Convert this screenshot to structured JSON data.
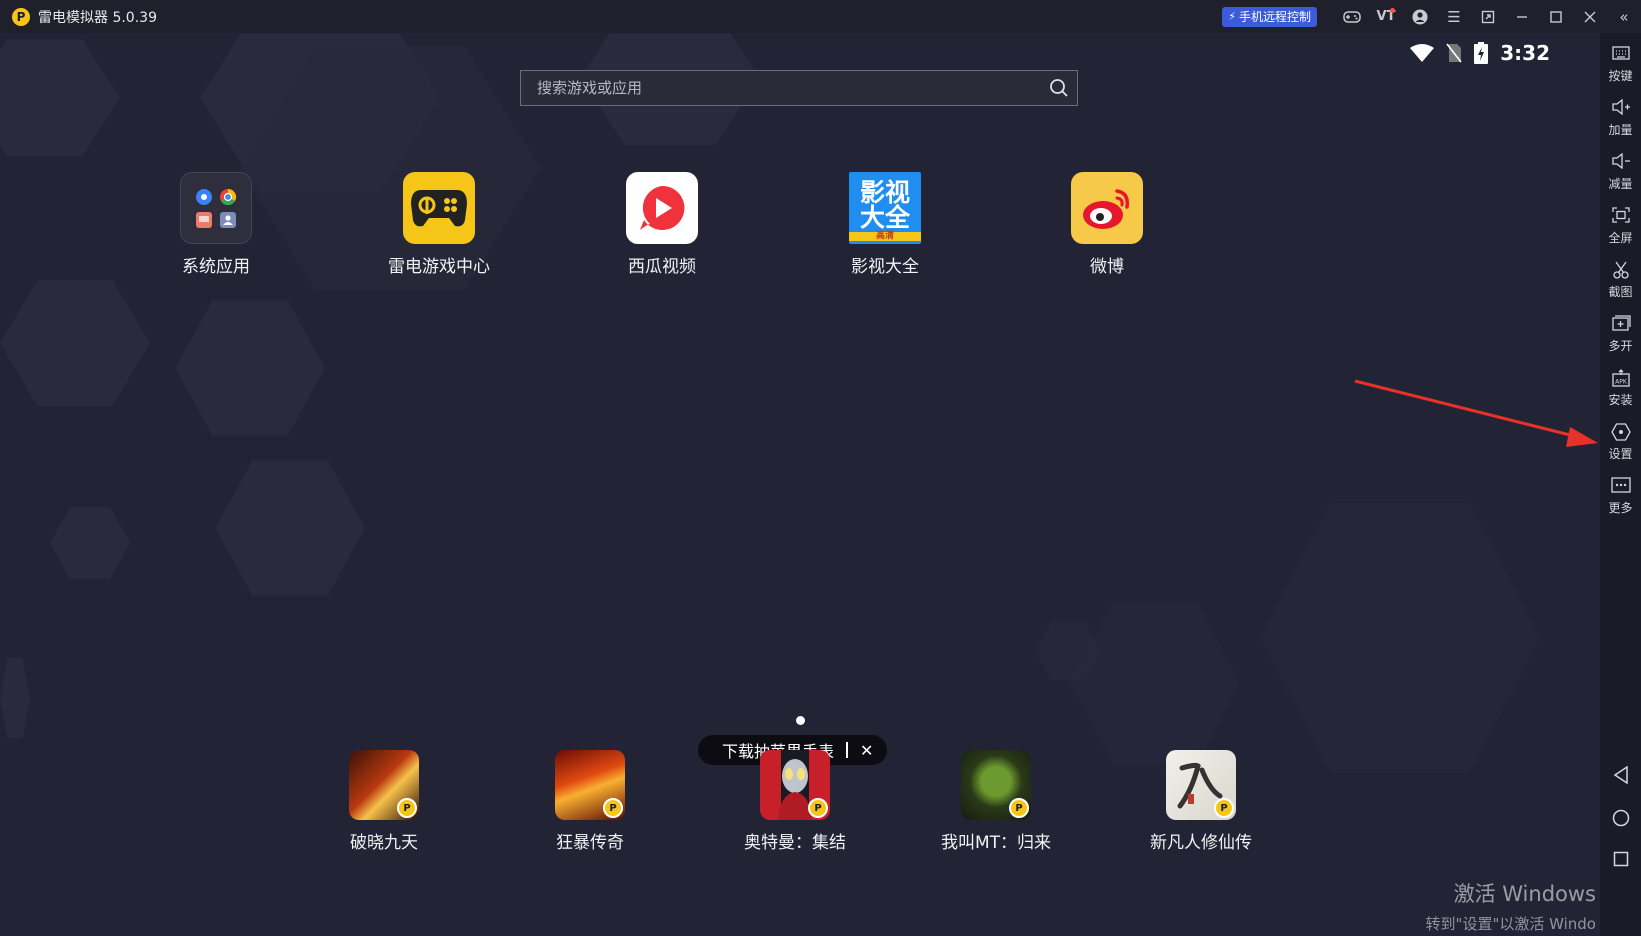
{
  "window": {
    "title": "雷电模拟器 5.0.39"
  },
  "titlebar": {
    "remote_control_label": "手机远程控制",
    "vt_label": "VT"
  },
  "status_bar": {
    "time": "3:32"
  },
  "search": {
    "placeholder": "搜索游戏或应用"
  },
  "apps": [
    {
      "label": "系统应用"
    },
    {
      "label": "雷电游戏中心"
    },
    {
      "label": "西瓜视频"
    },
    {
      "label": "影视大全",
      "icon_text_1": "影视",
      "icon_text_2": "大全",
      "icon_tag": "高清"
    },
    {
      "label": "微博"
    }
  ],
  "tooltip": {
    "text": "下载抽苹果手表",
    "close": "✕"
  },
  "dock": [
    {
      "label": "破晓九天"
    },
    {
      "label": "狂暴传奇"
    },
    {
      "label": "奥特曼：集结"
    },
    {
      "label": "我叫MT：归来"
    },
    {
      "label": "新凡人修仙传"
    }
  ],
  "sidebar": [
    {
      "label": "按键",
      "icon": "keyboard-icon"
    },
    {
      "label": "加量",
      "icon": "volume-up-icon"
    },
    {
      "label": "减量",
      "icon": "volume-down-icon"
    },
    {
      "label": "全屏",
      "icon": "fullscreen-icon"
    },
    {
      "label": "截图",
      "icon": "scissors-icon"
    },
    {
      "label": "多开",
      "icon": "multi-instance-icon"
    },
    {
      "label": "安装",
      "icon": "apk-install-icon"
    },
    {
      "label": "设置",
      "icon": "settings-icon"
    },
    {
      "label": "更多",
      "icon": "more-icon"
    }
  ],
  "watermark": {
    "line1": "激活 Windows",
    "line2": "转到\"设置\"以激活 Windo"
  },
  "colors": {
    "accent_yellow": "#f5c518",
    "remote_blue": "#3b5bdb",
    "arrow_red": "#e8312a"
  }
}
